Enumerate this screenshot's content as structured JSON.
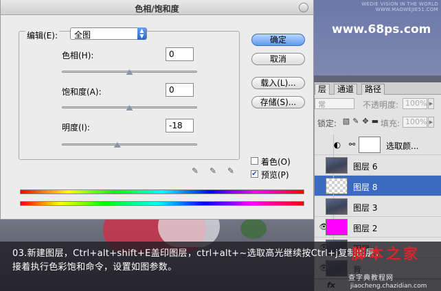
{
  "background": {
    "watermark_lines": [
      "WEDIE VISION IN THE WORLD",
      "WWW.MAOWEJIE51.COM"
    ],
    "site_url": "www.68ps.com"
  },
  "dialog": {
    "title": "色相/饱和度",
    "edit_label": "编辑(E):",
    "edit_value": "全图",
    "hue": {
      "label": "色相(H):",
      "value": "0",
      "level": 0.5
    },
    "saturation": {
      "label": "饱和度(A):",
      "value": "0",
      "level": 0.5
    },
    "lightness": {
      "label": "明度(I):",
      "value": "-18",
      "level": 0.41
    },
    "buttons": {
      "ok": "确定",
      "cancel": "取消",
      "load": "载入(L)...",
      "save": "存储(S)..."
    },
    "colorize": {
      "label": "着色(O)",
      "checked": false
    },
    "preview": {
      "label": "预览(P)",
      "checked": true
    },
    "eyedroppers": [
      "eyedropper-icon",
      "eyedropper-plus-icon",
      "eyedropper-minus-icon"
    ]
  },
  "layers_panel": {
    "tabs": [
      "层",
      "通道",
      "路径"
    ],
    "blend_mode": "常",
    "opacity_label": "不透明度:",
    "opacity_value": "100%",
    "lock_label": "锁定:",
    "fill_label": "填充:",
    "fill_value": "100%",
    "layers": [
      {
        "name": "选取颜...",
        "type": "adjustment",
        "thumb": "white",
        "visible": false,
        "selected": false
      },
      {
        "name": "图层 6",
        "thumb": "photo",
        "visible": false,
        "selected": false
      },
      {
        "name": "图层 8",
        "thumb": "checker",
        "visible": false,
        "selected": true
      },
      {
        "name": "图层 3",
        "thumb": "photo",
        "visible": false,
        "selected": false
      },
      {
        "name": "图层 2",
        "thumb": "magenta",
        "visible": true,
        "selected": false
      },
      {
        "name": "图层",
        "thumb": "photo",
        "visible": true,
        "selected": false
      },
      {
        "name": "背",
        "thumb": "photo",
        "visible": true,
        "selected": false
      }
    ],
    "footer_icon": "fx"
  },
  "caption": {
    "line1": "03.新建图层，Ctrl+alt+shift+E盖印图层，ctrl+alt+~选取高光继续按Ctrl+j复制图层，",
    "line2": "接着执行色彩饱和命令，设置如图参数。"
  },
  "brand": {
    "name": "脚本之家",
    "sub": "查字典教程网",
    "url": "jiaocheng.chazidian.com"
  },
  "colors": {
    "selected_layer": "#3b6bc0",
    "default_button": "#5d9af2",
    "brand_red": "#d8262b"
  }
}
